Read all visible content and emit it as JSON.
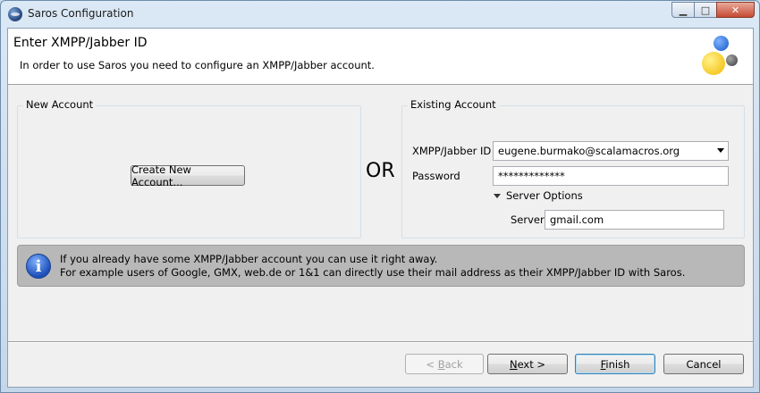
{
  "window": {
    "title": "Saros Configuration",
    "minimize_glyph": "▁",
    "maximize_glyph": "□",
    "close_glyph": "✕"
  },
  "header": {
    "title": "Enter XMPP/Jabber ID",
    "description": "In order to use Saros you need to configure an XMPP/Jabber account."
  },
  "new_account": {
    "group_label": "New Account",
    "create_button": "Create New Account..."
  },
  "or_label": "OR",
  "existing_account": {
    "group_label": "Existing Account",
    "jid_label": "XMPP/Jabber ID",
    "jid_value": "eugene.burmako@scalamacros.org",
    "password_label": "Password",
    "password_value": "*************",
    "server_options_label": "Server Options",
    "server_label": "Server",
    "server_value": "gmail.com"
  },
  "info": {
    "line1": "If you already have some XMPP/Jabber account you can use it right away.",
    "line2": "For example users of Google, GMX, web.de or 1&1 can directly use their mail address as their XMPP/Jabber ID with Saros.",
    "icon_glyph": "i"
  },
  "buttons": {
    "back_prefix": "< ",
    "back_mnemonic": "B",
    "back_rest": "ack",
    "next_mnemonic": "N",
    "next_rest": "ext >",
    "finish_mnemonic": "F",
    "finish_rest": "inish",
    "cancel": "Cancel"
  },
  "colors": {
    "info_background": "#b8b8b8",
    "default_button_border": "#3c7fb1"
  }
}
